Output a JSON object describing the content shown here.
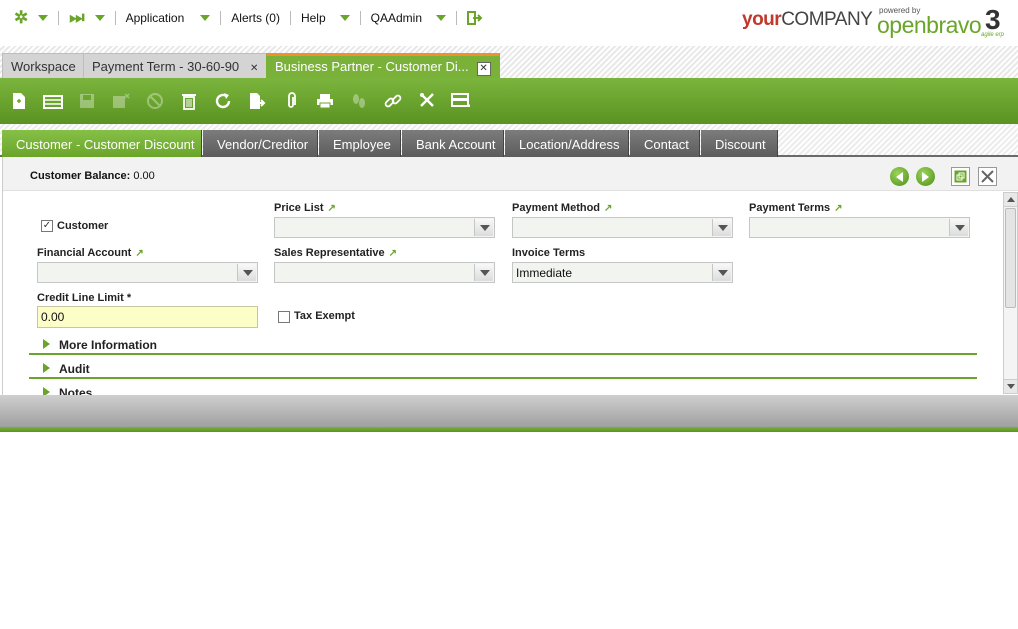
{
  "topnav": {
    "application": "Application",
    "alerts": "Alerts (0)",
    "help": "Help",
    "user": "QAAdmin"
  },
  "logos": {
    "company_your": "your",
    "company_company": "COMPANY",
    "powered_by": "powered by",
    "openbravo": "openbravo",
    "version": "3",
    "tagline": "agile erp"
  },
  "window_tabs": [
    {
      "label": "Workspace"
    },
    {
      "label": "Payment Term - 30-60-90"
    },
    {
      "label": "Business Partner - Customer Di..."
    }
  ],
  "sub_tabs": [
    {
      "label": "Customer - Customer Discount"
    },
    {
      "label": "Vendor/Creditor"
    },
    {
      "label": "Employee"
    },
    {
      "label": "Bank Account"
    },
    {
      "label": "Location/Address"
    },
    {
      "label": "Contact"
    },
    {
      "label": "Discount"
    }
  ],
  "header": {
    "balance_label": "Customer Balance:",
    "balance_value": "0.00"
  },
  "form": {
    "customer_label": "Customer",
    "customer_checked": "✓",
    "price_list_label": "Price List",
    "price_list_value": "",
    "payment_method_label": "Payment Method",
    "payment_method_value": "",
    "payment_terms_label": "Payment Terms",
    "payment_terms_value": "",
    "financial_account_label": "Financial Account",
    "financial_account_value": "",
    "sales_rep_label": "Sales Representative",
    "sales_rep_value": "",
    "invoice_terms_label": "Invoice Terms",
    "invoice_terms_value": "Immediate",
    "credit_limit_label": "Credit Line Limit *",
    "credit_limit_value": "0.00",
    "tax_exempt_label": "Tax Exempt",
    "link_glyph": "↗"
  },
  "sections": [
    {
      "label": "More Information"
    },
    {
      "label": "Audit"
    },
    {
      "label": "Notes"
    }
  ],
  "colors": {
    "brand_green": "#6aa52a",
    "active_tab_accent": "#f0912f",
    "required_field_bg": "#fdfdc8"
  }
}
